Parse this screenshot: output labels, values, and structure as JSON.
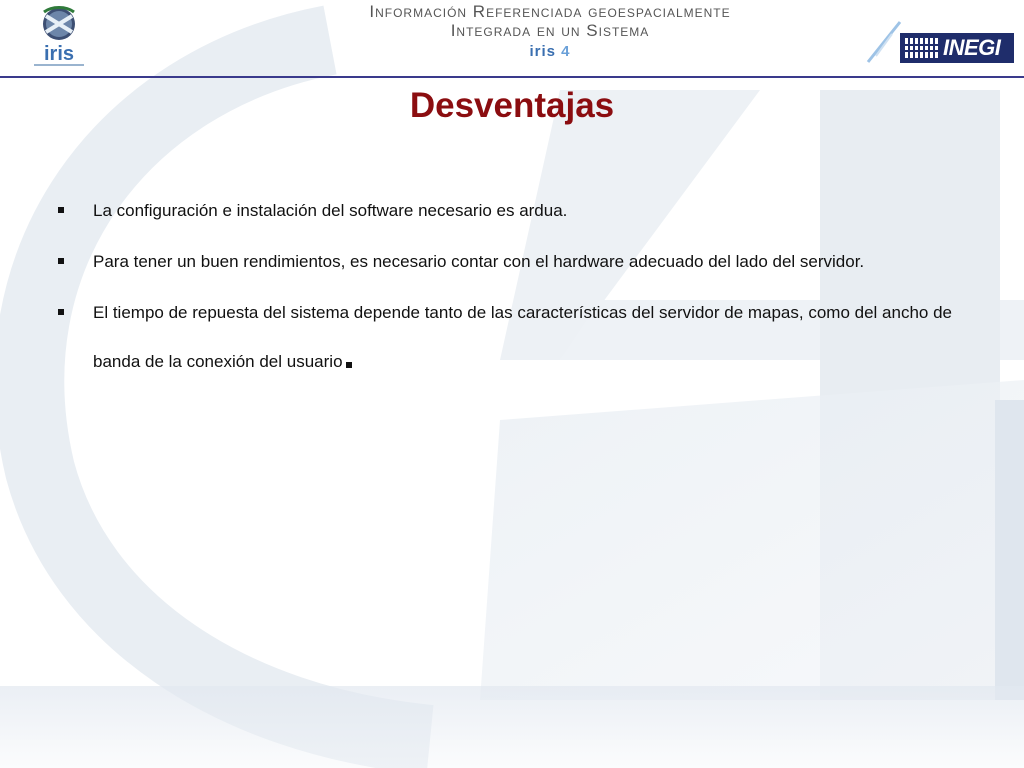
{
  "header": {
    "title_line1": "Información Referenciada geoespacialmente",
    "title_line2": "Integrada en un Sistema",
    "title_line3_word": "iris",
    "title_line3_number": "4",
    "logo_left_text": "iris",
    "logo_right_text": "INEGI"
  },
  "slide": {
    "title": "Desventajas",
    "bullets": [
      {
        "text": "La configuración e instalación del software necesario es ardua."
      },
      {
        "text": "Para tener un buen rendimientos, es necesario contar con el hardware adecuado del lado del servidor."
      },
      {
        "text": "El tiempo de repuesta del sistema depende tanto de las características del servidor de mapas, como del ancho de banda de la conexión del usuario"
      }
    ]
  },
  "colors": {
    "title": "#8b0d10",
    "header_rule": "#3a3a8c",
    "inegi_bg": "#1f2d6b"
  }
}
